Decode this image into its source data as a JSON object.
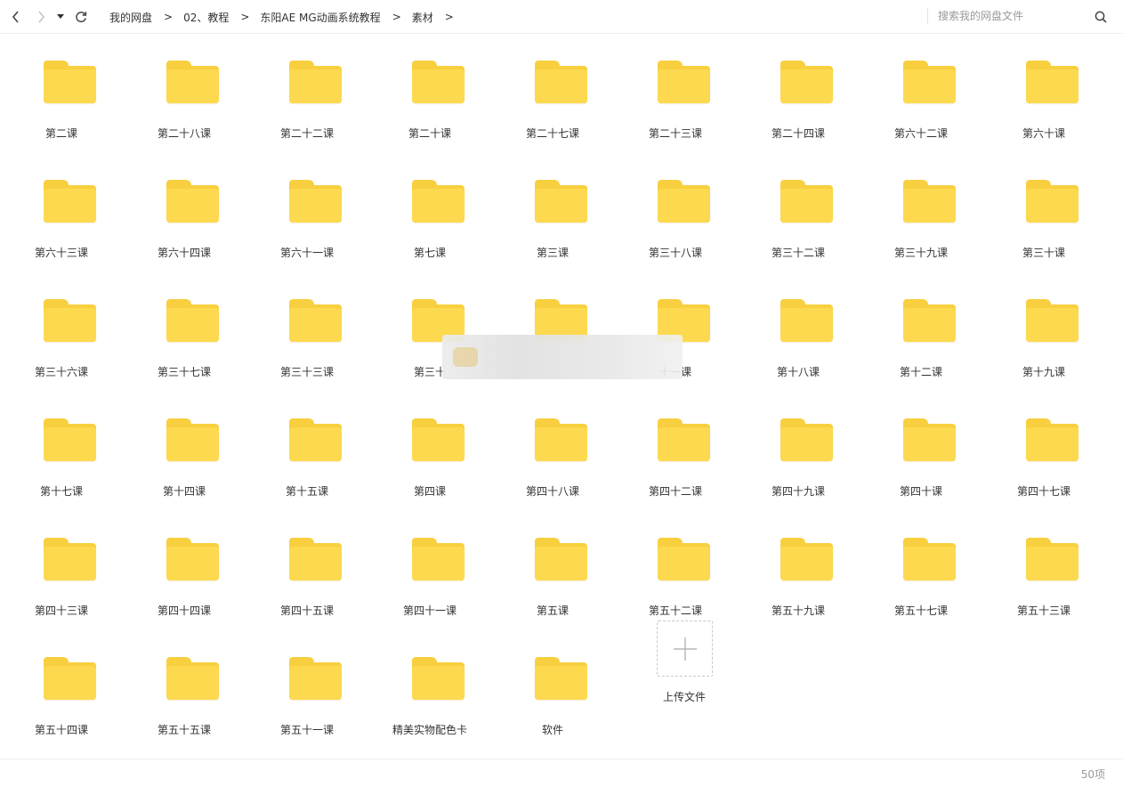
{
  "toolbar": {
    "back_icon": "chevron-left-icon",
    "forward_icon": "chevron-right-icon",
    "history_dropdown_icon": "caret-down-icon",
    "refresh_icon": "refresh-icon",
    "breadcrumb": [
      "我的网盘",
      "02、教程",
      "东阳AE MG动画系统教程",
      "素材"
    ],
    "breadcrumb_separator": ">",
    "search_placeholder": "搜索我的网盘文件",
    "search_icon": "search-icon"
  },
  "colors": {
    "folder_front": "#fdd94f",
    "folder_back": "#f8cf3e",
    "text": "#333333",
    "muted_text": "#9a9a9a"
  },
  "folders": [
    "第二课",
    "第二十八课",
    "第二十二课",
    "第二十课",
    "第二十七课",
    "第二十三课",
    "第二十四课",
    "第六十二课",
    "第六十课",
    "第六十三课",
    "第六十四课",
    "第六十一课",
    "第七课",
    "第三课",
    "第三十八课",
    "第三十二课",
    "第三十九课",
    "第三十课",
    "第三十六课",
    "第三十七课",
    "第三十三课",
    "第三十",
    "",
    "十一课",
    "第十八课",
    "第十二课",
    "第十九课",
    "第十七课",
    "第十四课",
    "第十五课",
    "第四课",
    "第四十八课",
    "第四十二课",
    "第四十九课",
    "第四十课",
    "第四十七课",
    "第四十三课",
    "第四十四课",
    "第四十五课",
    "第四十一课",
    "第五课",
    "第五十二课",
    "第五十九课",
    "第五十七课",
    "第五十三课",
    "第五十四课",
    "第五十五课",
    "第五十一课",
    "精美实物配色卡",
    "软件"
  ],
  "upload": {
    "label": "上传文件",
    "icon": "plus-icon"
  },
  "footer": {
    "item_count": "50项"
  }
}
